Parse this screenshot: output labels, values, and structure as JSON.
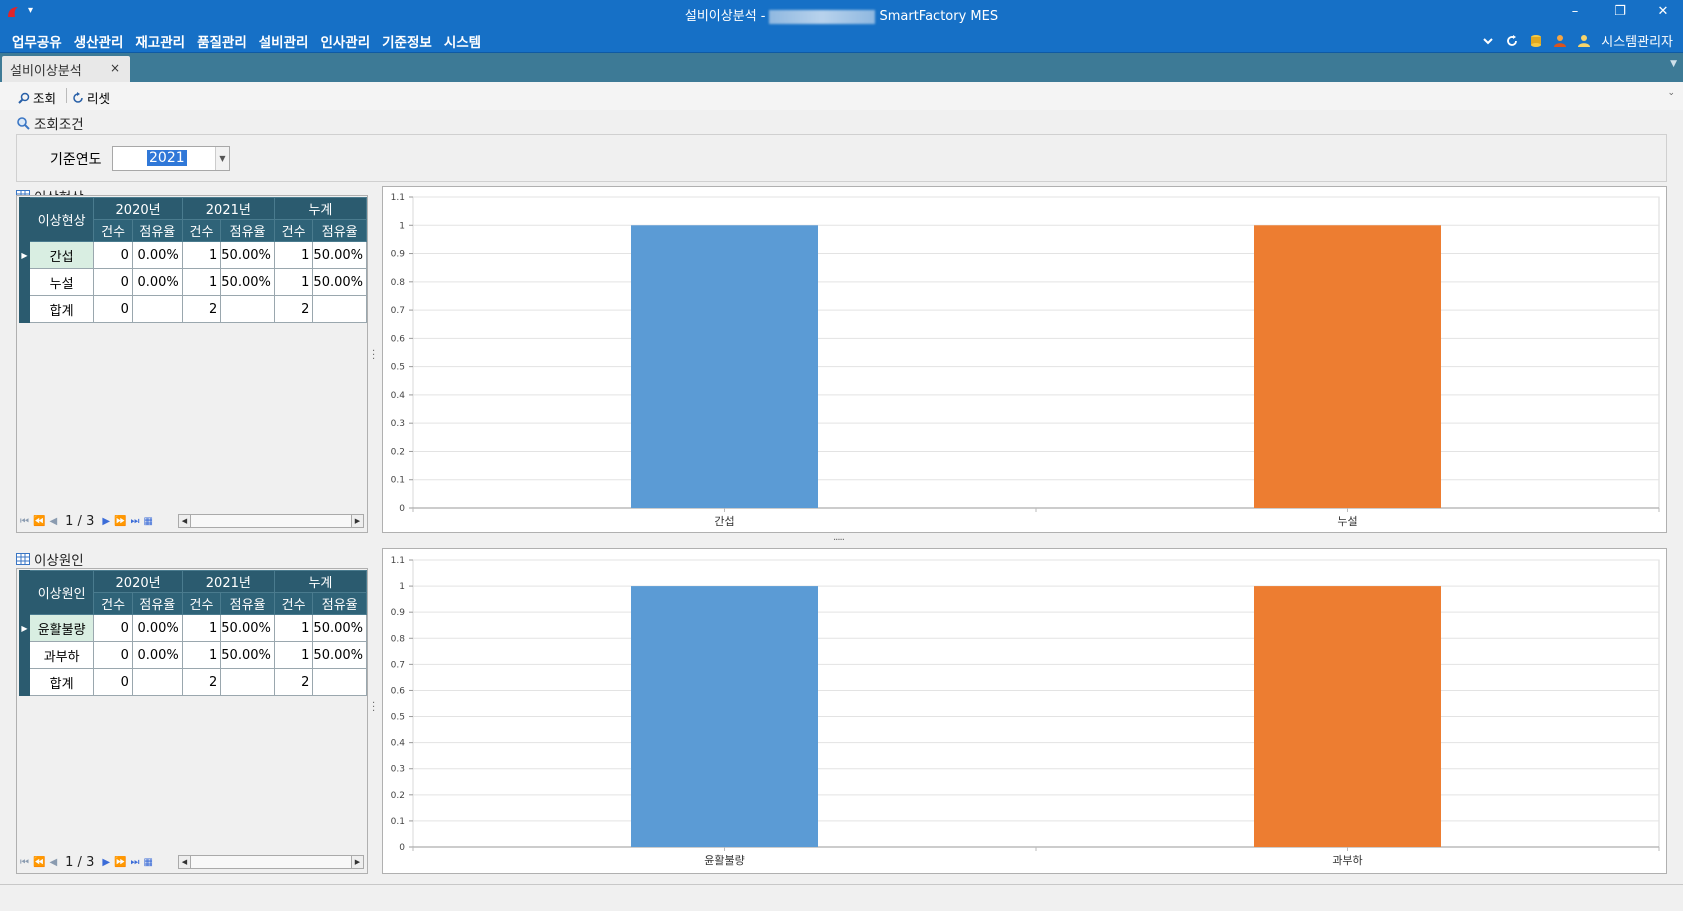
{
  "window": {
    "title_prefix": "설비이상분석 -",
    "title_suffix": "SmartFactory MES",
    "minimize": "–",
    "restore": "❐",
    "close": "✕"
  },
  "menu": {
    "items": [
      "업무공유",
      "생산관리",
      "재고관리",
      "품질관리",
      "설비관리",
      "인사관리",
      "기준정보",
      "시스템"
    ],
    "user": "시스템관리자"
  },
  "tab": {
    "label": "설비이상분석",
    "close": "×"
  },
  "toolbar": {
    "search_label": "조회",
    "reset_label": "리셋"
  },
  "condition": {
    "title": "조회조건",
    "year_label": "기준연도",
    "year_value": "2021"
  },
  "grid1": {
    "title": "이상현상",
    "row_header": "이상현상",
    "years": [
      "2020년",
      "2021년",
      "누계"
    ],
    "sub_headers": [
      "건수",
      "점유율"
    ],
    "rows": [
      {
        "cat": "간섭",
        "v": [
          "0",
          "0.00%",
          "1",
          "50.00%",
          "1",
          "50.00%"
        ]
      },
      {
        "cat": "누설",
        "v": [
          "0",
          "0.00%",
          "1",
          "50.00%",
          "1",
          "50.00%"
        ]
      },
      {
        "cat": "합계",
        "v": [
          "0",
          "",
          "2",
          "",
          "2",
          ""
        ]
      }
    ],
    "page": "1 / 3"
  },
  "grid2": {
    "title": "이상원인",
    "row_header": "이상원인",
    "years": [
      "2020년",
      "2021년",
      "누계"
    ],
    "sub_headers": [
      "건수",
      "점유율"
    ],
    "rows": [
      {
        "cat": "윤활불량",
        "v": [
          "0",
          "0.00%",
          "1",
          "50.00%",
          "1",
          "50.00%"
        ]
      },
      {
        "cat": "과부하",
        "v": [
          "0",
          "0.00%",
          "1",
          "50.00%",
          "1",
          "50.00%"
        ]
      },
      {
        "cat": "합계",
        "v": [
          "0",
          "",
          "2",
          "",
          "2",
          ""
        ]
      }
    ],
    "page": "1 / 3"
  },
  "chart_data": [
    {
      "type": "bar",
      "categories": [
        "간섭",
        "누설"
      ],
      "values": [
        1,
        1
      ],
      "colors": [
        "#5b9bd5",
        "#ed7d31"
      ],
      "ylim": [
        0,
        1.1
      ],
      "yticks": [
        0,
        0.1,
        0.2,
        0.3,
        0.4,
        0.5,
        0.6,
        0.7,
        0.8,
        0.9,
        1,
        1.1
      ],
      "grid": true
    },
    {
      "type": "bar",
      "categories": [
        "윤활불량",
        "과부하"
      ],
      "values": [
        1,
        1
      ],
      "colors": [
        "#5b9bd5",
        "#ed7d31"
      ],
      "ylim": [
        0,
        1.1
      ],
      "yticks": [
        0,
        0.1,
        0.2,
        0.3,
        0.4,
        0.5,
        0.6,
        0.7,
        0.8,
        0.9,
        1,
        1.1
      ],
      "grid": true
    }
  ]
}
